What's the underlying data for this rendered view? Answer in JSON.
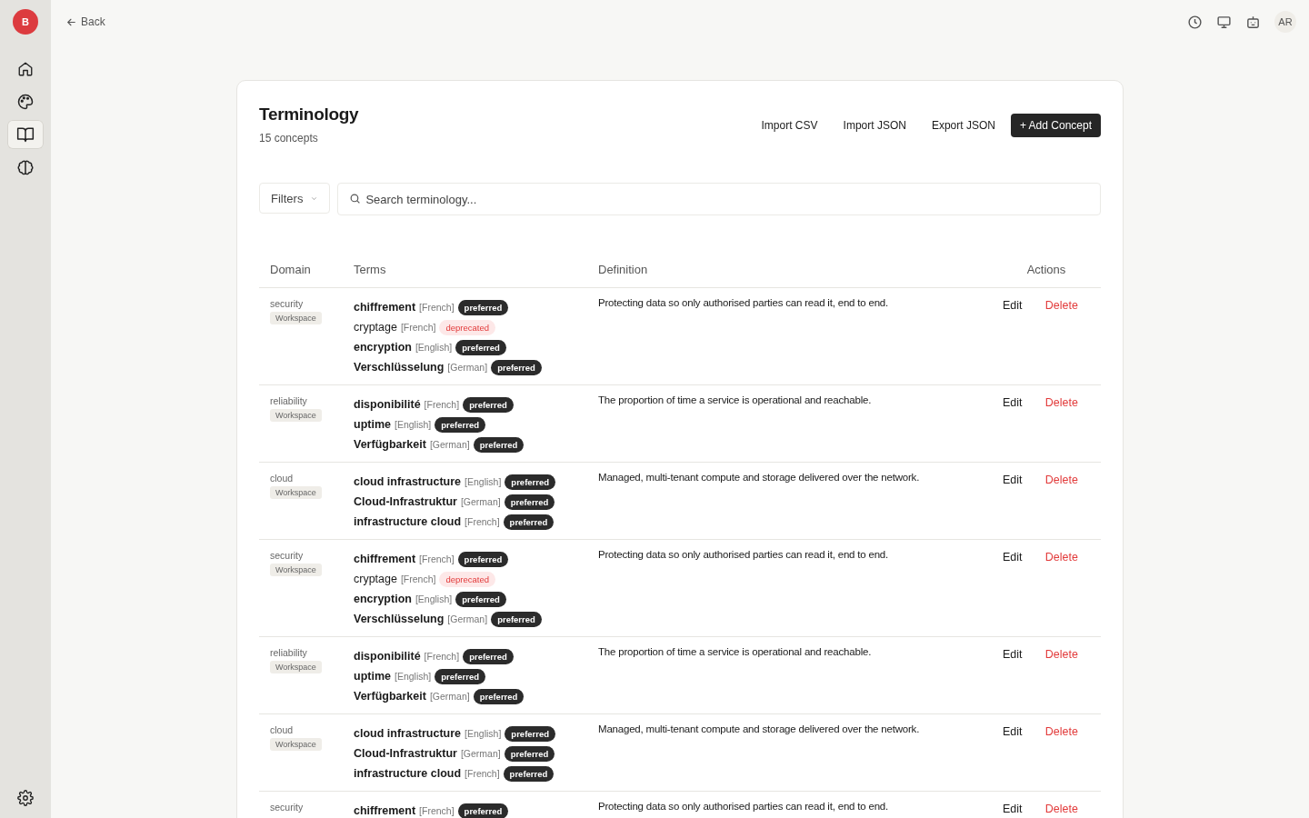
{
  "sidebar": {
    "logo": "B",
    "items": [
      {
        "selected": false
      },
      {
        "selected": false
      },
      {
        "selected": true
      },
      {
        "selected": false
      }
    ]
  },
  "topbar": {
    "back": "Back",
    "avatar": "AR"
  },
  "header": {
    "title": "Terminology",
    "count": "15 concepts",
    "buttons": [
      {
        "label": "Import CSV",
        "kind": "plain"
      },
      {
        "label": "Import JSON",
        "kind": "plain"
      },
      {
        "label": "Export JSON",
        "kind": "plain"
      },
      {
        "label": "+ Add Concept",
        "kind": "primary"
      }
    ]
  },
  "filters": {
    "label": "Filters"
  },
  "search": {
    "placeholder": "Search terminology..."
  },
  "table": {
    "columns": [
      "Domain",
      "Terms",
      "Definition",
      "Actions"
    ],
    "rows": [
      {
        "domain": "security",
        "scope": "Workspace",
        "terms": [
          {
            "term": "chiffrement",
            "lang": "[French]",
            "status": "preferred"
          },
          {
            "term": "cryptage",
            "lang": "[French]",
            "status": "deprecated"
          },
          {
            "term": "encryption",
            "lang": "[English]",
            "status": "preferred"
          },
          {
            "term": "Verschlüsselung",
            "lang": "[German]",
            "status": "preferred"
          }
        ],
        "definition": "Protecting data so only authorised parties can read it, end to end.",
        "edit": "Edit",
        "delete": "Delete"
      },
      {
        "domain": "reliability",
        "scope": "Workspace",
        "terms": [
          {
            "term": "disponibilité",
            "lang": "[French]",
            "status": "preferred"
          },
          {
            "term": "uptime",
            "lang": "[English]",
            "status": "preferred"
          },
          {
            "term": "Verfügbarkeit",
            "lang": "[German]",
            "status": "preferred"
          }
        ],
        "definition": "The proportion of time a service is operational and reachable.",
        "edit": "Edit",
        "delete": "Delete"
      },
      {
        "domain": "cloud",
        "scope": "Workspace",
        "terms": [
          {
            "term": "cloud infrastructure",
            "lang": "[English]",
            "status": "preferred"
          },
          {
            "term": "Cloud-Infrastruktur",
            "lang": "[German]",
            "status": "preferred"
          },
          {
            "term": "infrastructure cloud",
            "lang": "[French]",
            "status": "preferred"
          }
        ],
        "definition": "Managed, multi-tenant compute and storage delivered over the network.",
        "edit": "Edit",
        "delete": "Delete"
      },
      {
        "domain": "security",
        "scope": "Workspace",
        "terms": [
          {
            "term": "chiffrement",
            "lang": "[French]",
            "status": "preferred"
          },
          {
            "term": "cryptage",
            "lang": "[French]",
            "status": "deprecated"
          },
          {
            "term": "encryption",
            "lang": "[English]",
            "status": "preferred"
          },
          {
            "term": "Verschlüsselung",
            "lang": "[German]",
            "status": "preferred"
          }
        ],
        "definition": "Protecting data so only authorised parties can read it, end to end.",
        "edit": "Edit",
        "delete": "Delete"
      },
      {
        "domain": "reliability",
        "scope": "Workspace",
        "terms": [
          {
            "term": "disponibilité",
            "lang": "[French]",
            "status": "preferred"
          },
          {
            "term": "uptime",
            "lang": "[English]",
            "status": "preferred"
          },
          {
            "term": "Verfügbarkeit",
            "lang": "[German]",
            "status": "preferred"
          }
        ],
        "definition": "The proportion of time a service is operational and reachable.",
        "edit": "Edit",
        "delete": "Delete"
      },
      {
        "domain": "cloud",
        "scope": "Workspace",
        "terms": [
          {
            "term": "cloud infrastructure",
            "lang": "[English]",
            "status": "preferred"
          },
          {
            "term": "Cloud-Infrastruktur",
            "lang": "[German]",
            "status": "preferred"
          },
          {
            "term": "infrastructure cloud",
            "lang": "[French]",
            "status": "preferred"
          }
        ],
        "definition": "Managed, multi-tenant compute and storage delivered over the network.",
        "edit": "Edit",
        "delete": "Delete"
      },
      {
        "domain": "security",
        "terms": [
          {
            "term": "chiffrement",
            "lang": "[French]",
            "status": "preferred"
          }
        ],
        "definition": "Protecting data so only authorised parties can read it, end to end.",
        "edit": "Edit",
        "delete": "Delete"
      }
    ]
  }
}
